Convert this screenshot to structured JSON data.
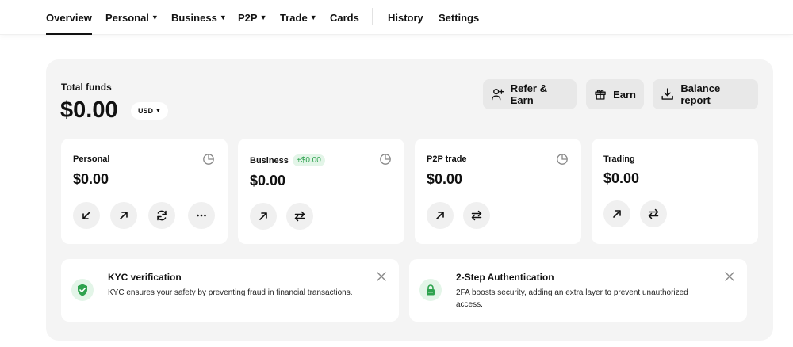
{
  "nav": {
    "overview": "Overview",
    "personal": "Personal",
    "business": "Business",
    "p2p": "P2P",
    "trade": "Trade",
    "cards": "Cards",
    "history": "History",
    "settings": "Settings",
    "active": "overview"
  },
  "funds": {
    "label": "Total funds",
    "amount": "$0.00",
    "currency": "USD"
  },
  "actions": {
    "refer": "Refer & Earn",
    "earn": "Earn",
    "report": "Balance report"
  },
  "cards": {
    "personal": {
      "title": "Personal",
      "amount": "$0.00"
    },
    "business": {
      "title": "Business",
      "badge": "+$0.00",
      "amount": "$0.00"
    },
    "p2p": {
      "title": "P2P trade",
      "amount": "$0.00"
    },
    "trading": {
      "title": "Trading",
      "amount": "$0.00"
    }
  },
  "notices": {
    "kyc": {
      "title": "KYC verification",
      "text": "KYC ensures your safety by preventing fraud in financial transactions."
    },
    "twofa": {
      "title": "2-Step Authentication",
      "text": "2FA boosts security, adding an extra layer to prevent unauthorized access."
    }
  },
  "colors": {
    "accent_green": "#2ea24e",
    "panel_bg": "#f4f4f4",
    "button_bg": "#e8e8e8"
  },
  "icons": {
    "refer": "add-user-icon",
    "earn": "gift-icon",
    "report": "download-icon",
    "card_history": "clock-history-icon",
    "kyc": "shield-check-icon",
    "twofa": "lock-icon",
    "close": "close-icon"
  }
}
